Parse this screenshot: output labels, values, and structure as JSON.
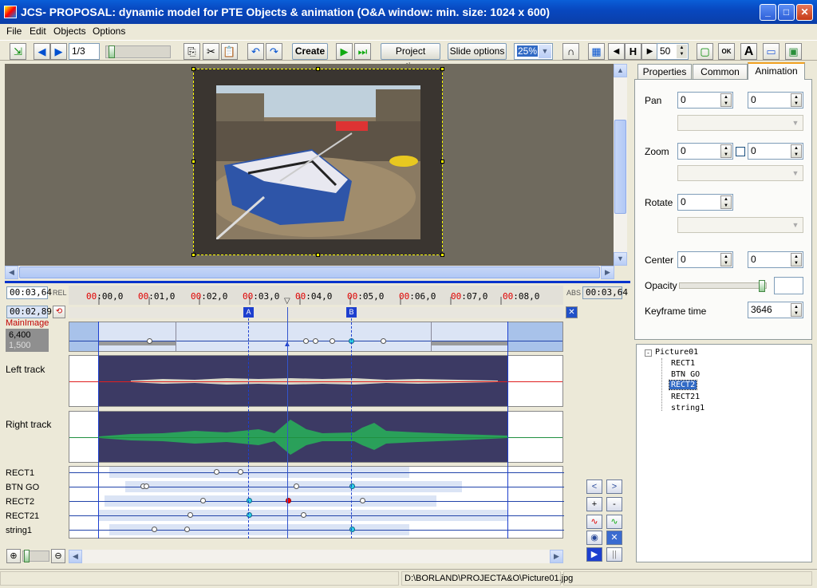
{
  "window": {
    "title": "JCS- PROPOSAL: dynamic model for PTE Objects & animation (O&A window: min. size: 1024 x 600)"
  },
  "menu": [
    "File",
    "Edit",
    "Objects",
    "Options"
  ],
  "toolbar": {
    "slide_counter": "1/3",
    "create_label": "Create",
    "project_options_label": "Project options",
    "slide_options_label": "Slide options",
    "zoom_value": "25%",
    "h_label": "H",
    "grid_value": "50",
    "ok_label": "OK",
    "text_label": "A"
  },
  "timeline": {
    "current_time": "00:03,64",
    "rel_label": "REL",
    "abs_label": "ABS",
    "abs_time": "00:03,64",
    "cursor_time": "00:02,89",
    "ticks": [
      {
        "red": "00",
        "rest": ":00,0"
      },
      {
        "red": "00",
        "rest": ":01,0"
      },
      {
        "red": "00",
        "rest": ":02,0"
      },
      {
        "red": "00",
        "rest": ":03,0"
      },
      {
        "red": "00",
        "rest": ":04,0"
      },
      {
        "red": "00",
        "rest": ":05,0"
      },
      {
        "red": "00",
        "rest": ":06,0"
      },
      {
        "red": "00",
        "rest": ":07,0"
      },
      {
        "red": "00",
        "rest": ":08,0"
      }
    ],
    "marker_a": "A",
    "marker_b": "B",
    "main_image_label": "MainImage",
    "main_values": [
      "6,400",
      "1,500"
    ],
    "left_track_label": "Left track",
    "right_track_label": "Right track",
    "layers": [
      "RECT1",
      "BTN GO",
      "RECT2",
      "RECT21",
      "string1"
    ]
  },
  "animation": {
    "tabs": [
      "Properties",
      "Common",
      "Animation"
    ],
    "active_tab": "Animation",
    "pan_label": "Pan",
    "pan_x": "0",
    "pan_y": "0",
    "zoom_label": "Zoom",
    "zoom_x": "0",
    "zoom_y": "0",
    "rotate_label": "Rotate",
    "rotate_value": "0",
    "center_label": "Center",
    "center_x": "0",
    "center_y": "0",
    "opacity_label": "Opacity",
    "keyframe_label": "Keyframe time",
    "keyframe_value": "3646"
  },
  "tree": {
    "root": "Picture01",
    "children": [
      "RECT1",
      "BTN GO",
      "RECT2",
      "RECT21",
      "string1"
    ],
    "selected": "RECT2"
  },
  "status": {
    "path": "D:\\BORLAND\\PROJECTA&O\\Picture01.jpg"
  },
  "colors": {
    "title_bar": "#0848c0",
    "accent": "#0033cc",
    "waveform_left": "#d9d8c8",
    "waveform_right": "#2aa05a"
  }
}
